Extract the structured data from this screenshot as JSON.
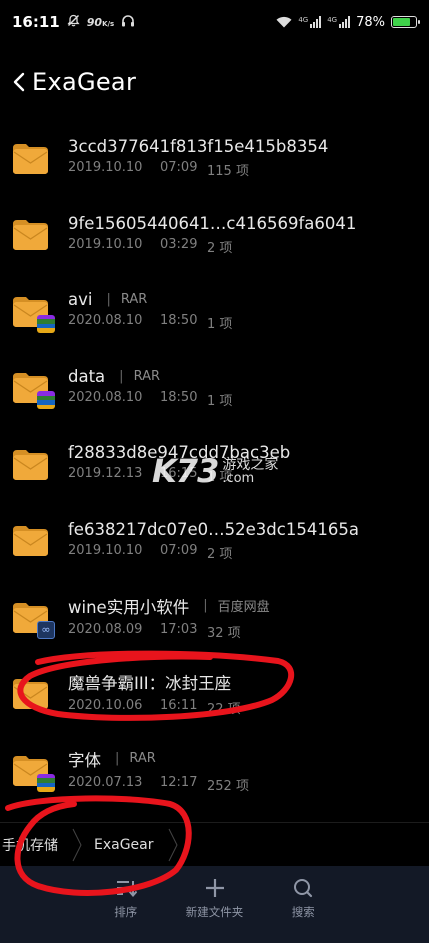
{
  "status_bar": {
    "time": "16:11",
    "speed": "90",
    "speed_unit": "K/s",
    "signal_tag_1": "4G",
    "signal_tag_2": "4G",
    "battery_percent": "78%",
    "battery_level": 0.78
  },
  "header": {
    "title": "ExaGear"
  },
  "files": [
    {
      "name": "3ccd377641f813f15e415b8354",
      "date": "2019.10.10",
      "time": "07:09",
      "count": "115 项",
      "tag": "",
      "badge": ""
    },
    {
      "name": "9fe15605440641…c416569fa6041",
      "date": "2019.10.10",
      "time": "03:29",
      "count": "2 项",
      "tag": "",
      "badge": ""
    },
    {
      "name": "avi",
      "date": "2020.08.10",
      "time": "18:50",
      "count": "1 项",
      "tag": "RAR",
      "badge": "rar"
    },
    {
      "name": "data",
      "date": "2020.08.10",
      "time": "18:50",
      "count": "1 项",
      "tag": "RAR",
      "badge": "rar"
    },
    {
      "name": "f28833d8e947cdd7bac3eb",
      "date": "2019.12.13",
      "time": "16:15",
      "count": "1 项",
      "tag": "",
      "badge": ""
    },
    {
      "name": "fe638217dc07e0…52e3dc154165a",
      "date": "2019.10.10",
      "time": "07:09",
      "count": "2 项",
      "tag": "",
      "badge": ""
    },
    {
      "name": "wine实用小软件",
      "date": "2020.08.09",
      "time": "17:03",
      "count": "32 项",
      "tag": "百度网盘",
      "badge": "pan"
    },
    {
      "name": "魔兽争霸III：冰封王座",
      "date": "2020.10.06",
      "time": "16:11",
      "count": "22 项",
      "tag": "",
      "badge": ""
    },
    {
      "name": "字体",
      "date": "2020.07.13",
      "time": "12:17",
      "count": "252 项",
      "tag": "RAR",
      "badge": "rar"
    }
  ],
  "watermark": {
    "logo": "K73",
    "cn": "游戏之家",
    "com": ".com"
  },
  "breadcrumb": {
    "root": "手机存储",
    "current": "ExaGear"
  },
  "toolbar": {
    "sort_label": "排序",
    "new_folder_label": "新建文件夹",
    "search_label": "搜索"
  },
  "colors": {
    "folder": "#f0a93a",
    "folder_dark": "#d58f24",
    "toolbar_bg": "#131926",
    "annotation": "#e8141c",
    "battery": "#3fd24a"
  }
}
